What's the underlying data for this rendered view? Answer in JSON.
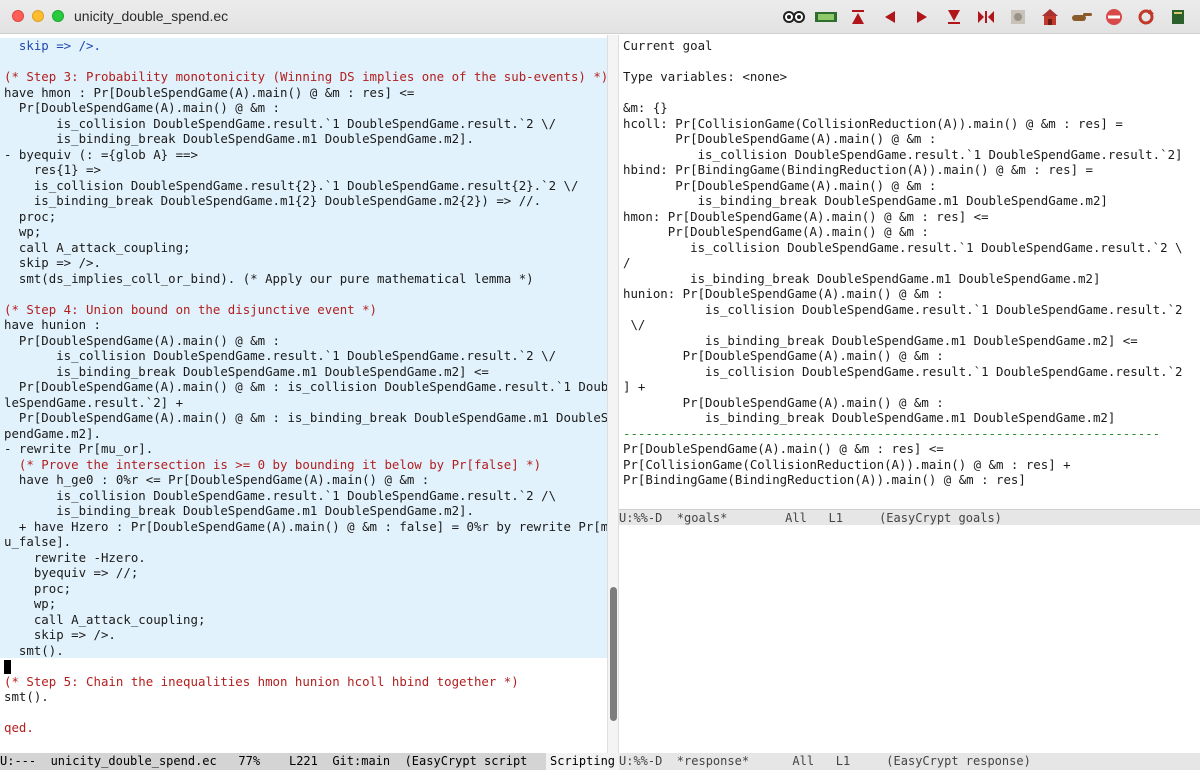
{
  "window": {
    "title": "unicity_double_spend.ec",
    "toolbar_icons": [
      "goggles-icon",
      "pg-logo-icon",
      "goto-top-icon",
      "undo-step-icon",
      "next-step-icon",
      "goto-end-icon",
      "goto-point-icon",
      "find-icon",
      "home-icon",
      "pointer-icon",
      "interrupt-icon",
      "restart-icon",
      "help-icon"
    ]
  },
  "editor": {
    "lines": [
      {
        "text": "  skip => />.",
        "locked": true,
        "cls": "tac"
      },
      {
        "text": "",
        "locked": true
      },
      {
        "text": "(* Step 3: Probability monotonicity (Winning DS implies one of the sub-events) *)",
        "locked": true,
        "cls": "cm"
      },
      {
        "text": "have hmon : Pr[DoubleSpendGame(A).main() @ &m : res] <=",
        "locked": true
      },
      {
        "text": "  Pr[DoubleSpendGame(A).main() @ &m :",
        "locked": true
      },
      {
        "text": "       is_collision DoubleSpendGame.result.`1 DoubleSpendGame.result.`2 \\/",
        "locked": true
      },
      {
        "text": "       is_binding_break DoubleSpendGame.m1 DoubleSpendGame.m2].",
        "locked": true
      },
      {
        "text": "- byequiv (: ={glob A} ==>",
        "locked": true
      },
      {
        "text": "    res{1} =>",
        "locked": true
      },
      {
        "text": "    is_collision DoubleSpendGame.result{2}.`1 DoubleSpendGame.result{2}.`2 \\/",
        "locked": true
      },
      {
        "text": "    is_binding_break DoubleSpendGame.m1{2} DoubleSpendGame.m2{2}) => //.",
        "locked": true
      },
      {
        "text": "  proc;",
        "locked": true
      },
      {
        "text": "  wp;",
        "locked": true
      },
      {
        "text": "  call A_attack_coupling;",
        "locked": true
      },
      {
        "text": "  skip => />.",
        "locked": true
      },
      {
        "text": "  smt(ds_implies_coll_or_bind). (* Apply our pure mathematical lemma *)",
        "locked": true
      },
      {
        "text": "",
        "locked": true
      },
      {
        "text": "(* Step 4: Union bound on the disjunctive event *)",
        "locked": true,
        "cls": "cm"
      },
      {
        "text": "have hunion :",
        "locked": true
      },
      {
        "text": "  Pr[DoubleSpendGame(A).main() @ &m :",
        "locked": true
      },
      {
        "text": "       is_collision DoubleSpendGame.result.`1 DoubleSpendGame.result.`2 \\/",
        "locked": true
      },
      {
        "text": "       is_binding_break DoubleSpendGame.m1 DoubleSpendGame.m2] <=",
        "locked": true
      },
      {
        "text": "  Pr[DoubleSpendGame(A).main() @ &m : is_collision DoubleSpendGame.result.`1 Doub",
        "locked": true
      },
      {
        "text": "leSpendGame.result.`2] +",
        "locked": true,
        "wrap": true
      },
      {
        "text": "  Pr[DoubleSpendGame(A).main() @ &m : is_binding_break DoubleSpendGame.m1 DoubleS",
        "locked": true
      },
      {
        "text": "pendGame.m2].",
        "locked": true,
        "wrap": true
      },
      {
        "text": "- rewrite Pr[mu_or].",
        "locked": true
      },
      {
        "text": "  (* Prove the intersection is >= 0 by bounding it below by Pr[false] *)",
        "locked": true,
        "cls": "cm"
      },
      {
        "text": "  have h_ge0 : 0%r <= Pr[DoubleSpendGame(A).main() @ &m :",
        "locked": true
      },
      {
        "text": "       is_collision DoubleSpendGame.result.`1 DoubleSpendGame.result.`2 /\\",
        "locked": true
      },
      {
        "text": "       is_binding_break DoubleSpendGame.m1 DoubleSpendGame.m2].",
        "locked": true
      },
      {
        "text": "  + have Hzero : Pr[DoubleSpendGame(A).main() @ &m : false] = 0%r by rewrite Pr[m",
        "locked": true
      },
      {
        "text": "u_false].",
        "locked": true,
        "wrap": true
      },
      {
        "text": "    rewrite -Hzero.",
        "locked": true
      },
      {
        "text": "    byequiv => //;",
        "locked": true
      },
      {
        "text": "    proc;",
        "locked": true
      },
      {
        "text": "    wp;",
        "locked": true
      },
      {
        "text": "    call A_attack_coupling;",
        "locked": true
      },
      {
        "text": "    skip => />.",
        "locked": true
      },
      {
        "text": "  smt().",
        "locked": true
      },
      {
        "text": "",
        "locked": false,
        "cursor": true
      },
      {
        "text": "(* Step 5: Chain the inequalities hmon hunion hcoll hbind together *)",
        "locked": false,
        "cls": "cm",
        "wrap": true
      },
      {
        "text": "smt().",
        "locked": false
      },
      {
        "text": "",
        "locked": false
      },
      {
        "text": "qed.",
        "locked": false,
        "cls": "cm"
      }
    ]
  },
  "goals": {
    "lines": [
      "Current goal",
      "",
      "Type variables: <none>",
      "",
      "&m: {}",
      "hcoll: Pr[CollisionGame(CollisionReduction(A)).main() @ &m : res] =",
      "       Pr[DoubleSpendGame(A).main() @ &m :",
      "          is_collision DoubleSpendGame.result.`1 DoubleSpendGame.result.`2]",
      "hbind: Pr[BindingGame(BindingReduction(A)).main() @ &m : res] =",
      "       Pr[DoubleSpendGame(A).main() @ &m :",
      "          is_binding_break DoubleSpendGame.m1 DoubleSpendGame.m2]",
      "hmon: Pr[DoubleSpendGame(A).main() @ &m : res] <=",
      "      Pr[DoubleSpendGame(A).main() @ &m :",
      "         is_collision DoubleSpendGame.result.`1 DoubleSpendGame.result.`2 \\",
      "/",
      "         is_binding_break DoubleSpendGame.m1 DoubleSpendGame.m2]",
      "hunion: Pr[DoubleSpendGame(A).main() @ &m :",
      "           is_collision DoubleSpendGame.result.`1 DoubleSpendGame.result.`2",
      " \\/",
      "           is_binding_break DoubleSpendGame.m1 DoubleSpendGame.m2] <=",
      "        Pr[DoubleSpendGame(A).main() @ &m :",
      "           is_collision DoubleSpendGame.result.`1 DoubleSpendGame.result.`2",
      "] +",
      "        Pr[DoubleSpendGame(A).main() @ &m :",
      "           is_binding_break DoubleSpendGame.m1 DoubleSpendGame.m2]",
      "------------------------------------------------------------------------",
      "Pr[DoubleSpendGame(A).main() @ &m : res] <=",
      "Pr[CollisionGame(CollisionReduction(A)).main() @ &m : res] +",
      "Pr[BindingGame(BindingReduction(A)).main() @ &m : res]"
    ]
  },
  "modelines": {
    "left": "U:---  unicity_double_spend.ec   77%    L221  Git:main  (EasyCrypt script",
    "scripting": "Scripting",
    "goals": "U:%%-D  *goals*        All   L1     (EasyCrypt goals)",
    "response": "U:%%-D  *response*      All   L1     (EasyCrypt response)"
  },
  "colors": {
    "locked_region": "#e2f2fc",
    "comment": "#b21e1e",
    "keyword": "#1f47b0",
    "modeline": "#d4d4d4"
  }
}
